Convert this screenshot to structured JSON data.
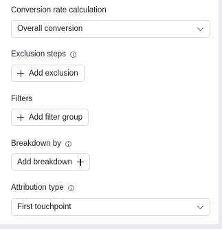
{
  "conversion": {
    "label": "Conversion rate calculation",
    "value": "Overall conversion"
  },
  "exclusion": {
    "label": "Exclusion steps",
    "button_label": "Add exclusion"
  },
  "filters": {
    "label": "Filters",
    "button_label": "Add filter group"
  },
  "breakdown": {
    "label": "Breakdown by",
    "button_label": "Add breakdown"
  },
  "attribution": {
    "label": "Attribution type",
    "value": "First touchpoint"
  }
}
